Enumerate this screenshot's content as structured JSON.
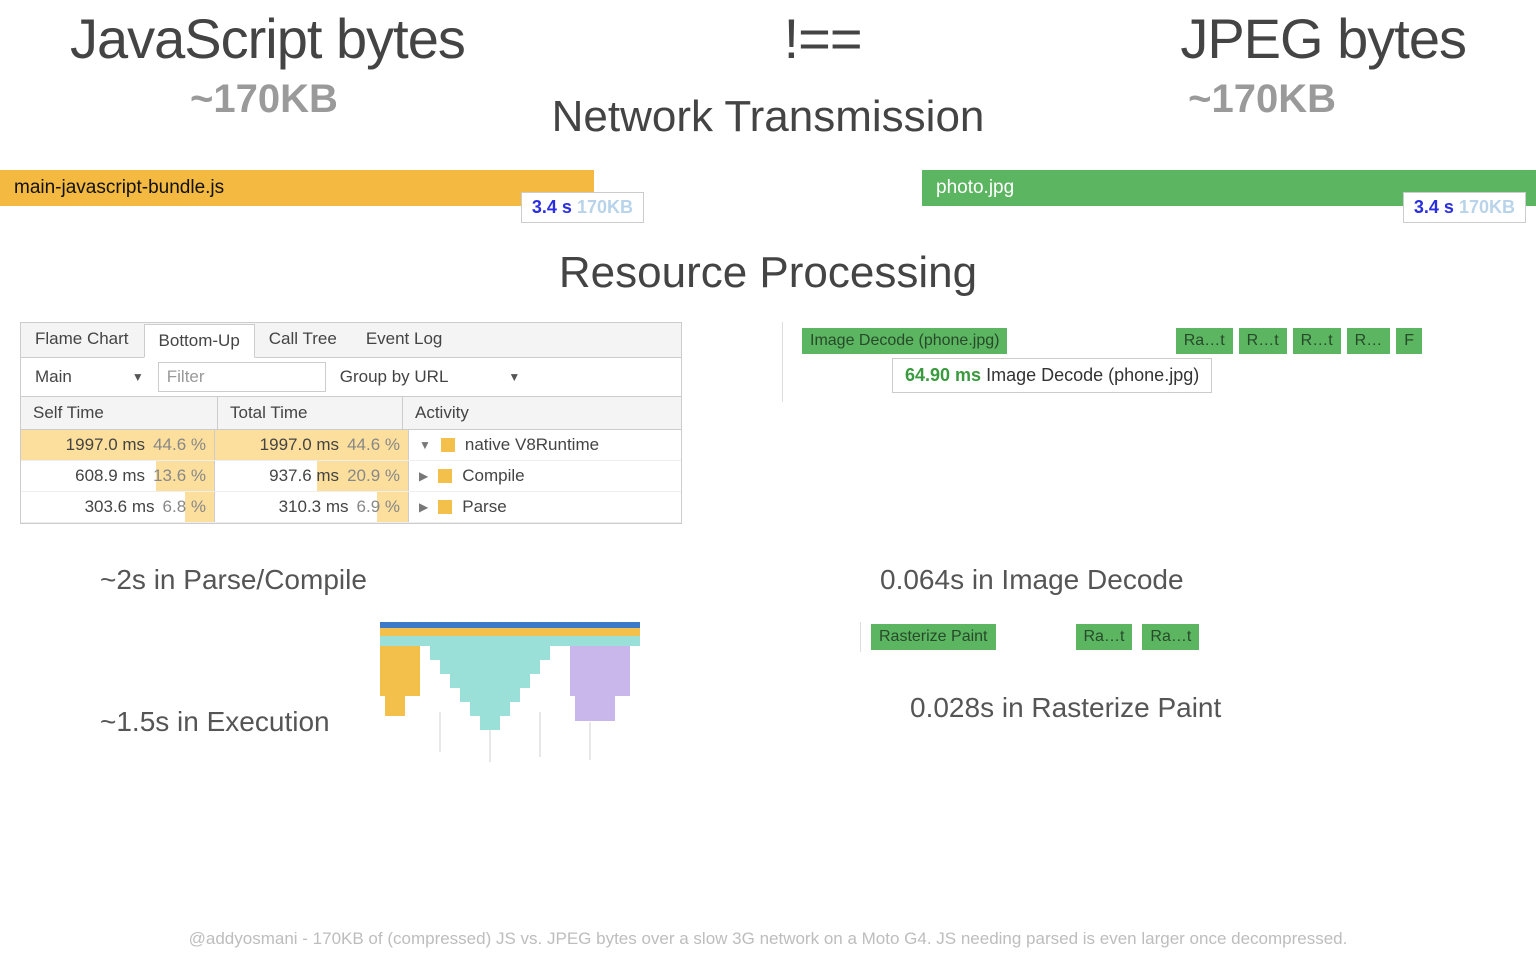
{
  "header": {
    "left": "JavaScript bytes",
    "mid": "!==",
    "right": "JPEG bytes",
    "left_size": "~170KB",
    "right_size": "~170KB"
  },
  "network_title": "Network Transmission",
  "bars": {
    "js": {
      "file": "main-javascript-bundle.js",
      "time": "3.4 s",
      "size": "170KB"
    },
    "jpg": {
      "file": "photo.jpg",
      "time": "3.4 s",
      "size": "170KB"
    }
  },
  "processing_title": "Resource Processing",
  "devtools": {
    "tabs": [
      "Flame Chart",
      "Bottom-Up",
      "Call Tree",
      "Event Log"
    ],
    "active_tab": 1,
    "thread": "Main",
    "filter_placeholder": "Filter",
    "group": "Group by URL",
    "cols": [
      "Self Time",
      "Total Time",
      "Activity"
    ],
    "rows": [
      {
        "self_ms": "1997.0 ms",
        "self_pct": "44.6 %",
        "self_bar": 100,
        "total_ms": "1997.0 ms",
        "total_pct": "44.6 %",
        "total_bar": 100,
        "tri": "▼",
        "activity": "native V8Runtime"
      },
      {
        "self_ms": "608.9 ms",
        "self_pct": "13.6 %",
        "self_bar": 30,
        "total_ms": "937.6 ms",
        "total_pct": "20.9 %",
        "total_bar": 47,
        "tri": "▶",
        "activity": "Compile"
      },
      {
        "self_ms": "303.6 ms",
        "self_pct": "6.8 %",
        "self_bar": 15,
        "total_ms": "310.3 ms",
        "total_pct": "6.9 %",
        "total_bar": 16,
        "tri": "▶",
        "activity": "Parse"
      }
    ]
  },
  "decode": {
    "main": "Image Decode (phone.jpg)",
    "small": [
      "Ra…t",
      "R…t",
      "R…t",
      "R…",
      "F"
    ],
    "tooltip_time": "64.90 ms",
    "tooltip_label": "Image Decode (phone.jpg)"
  },
  "stat": {
    "js_parse": "~2s in Parse/Compile",
    "img_decode": "0.064s in Image Decode",
    "js_exec": "~1.5s in Execution",
    "img_raster": "0.028s in Rasterize Paint"
  },
  "raster": {
    "main": "Rasterize Paint",
    "small": [
      "Ra…t",
      "Ra…t"
    ]
  },
  "footnote": "@addyosmani - 170KB of (compressed) JS vs. JPEG bytes over a slow 3G network on a Moto G4. JS needing parsed is even larger once decompressed."
}
